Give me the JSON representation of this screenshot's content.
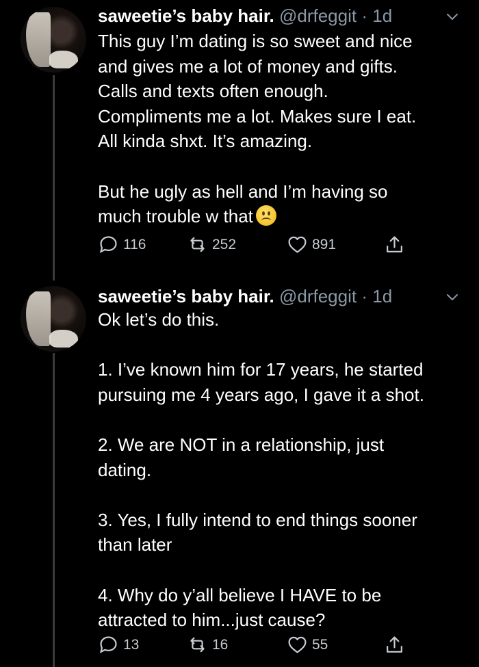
{
  "tweets": [
    {
      "name": "saweetie’s baby hair.",
      "handle": "@drfeggit",
      "dot": "·",
      "time": "1d",
      "text": "This guy I’m dating is so sweet and nice\nand gives me a lot of money and gifts.\nCalls and texts often enough.\nCompliments me a lot. Makes sure I eat.\nAll kinda shxt. It’s amazing.",
      "text2": "But he ugly as hell and I’m having so\nmuch trouble w that",
      "emoji": "frowning-face",
      "replies": "116",
      "retweets": "252",
      "likes": "891"
    },
    {
      "name": "saweetie’s baby hair.",
      "handle": "@drfeggit",
      "dot": "·",
      "time": "1d",
      "paragraphs": [
        "Ok let’s do this.",
        "1. I’ve known him for 17 years, he started\npursuing me 4 years ago, I gave it a shot.",
        "2. We are NOT in a relationship, just\ndating.",
        "3. Yes, I fully intend to end things sooner\nthan later",
        "4. Why do y’all believe I HAVE to be\nattracted to him...just cause?"
      ],
      "replies": "13",
      "retweets": "16",
      "likes": "55"
    }
  ],
  "colors": {
    "background": "#000000",
    "text": "#ffffff",
    "secondary": "#8b98a5",
    "thread_line": "#3b3b3b"
  }
}
